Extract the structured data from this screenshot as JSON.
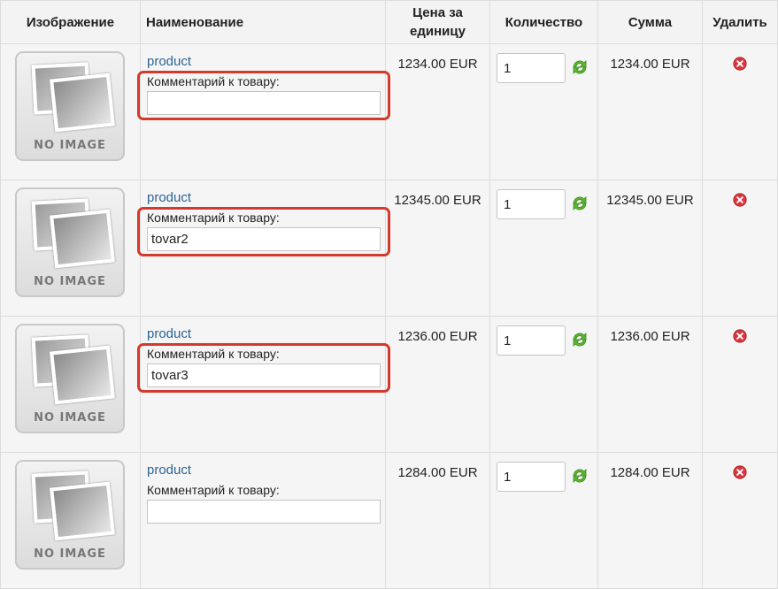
{
  "headers": {
    "image": "Изображение",
    "name": "Наименование",
    "price": "Цена за единицу",
    "quantity": "Количество",
    "sum": "Сумма",
    "delete": "Удалить"
  },
  "no_image_text": "NO IMAGE",
  "rows": [
    {
      "product": "product",
      "comment_label": "Комментарий к товару:",
      "comment": "",
      "price": "1234.00 EUR",
      "qty": "1",
      "sum": "1234.00 EUR",
      "highlighted": true
    },
    {
      "product": "product",
      "comment_label": "Комментарий к товару:",
      "comment": "tovar2",
      "price": "12345.00 EUR",
      "qty": "1",
      "sum": "12345.00 EUR",
      "highlighted": true
    },
    {
      "product": "product",
      "comment_label": "Комментарий к товару:",
      "comment": "tovar3",
      "price": "1236.00 EUR",
      "qty": "1",
      "sum": "1236.00 EUR",
      "highlighted": true
    },
    {
      "product": "product",
      "comment_label": "Комментарий к товару:",
      "comment": "",
      "price": "1284.00 EUR",
      "qty": "1",
      "sum": "1284.00 EUR",
      "highlighted": false
    }
  ],
  "colors": {
    "highlight": "#d23a2e",
    "link": "#2a6496",
    "refresh": "#5cb531",
    "delete": "#d9363e"
  },
  "icons": {
    "refresh": "refresh-icon",
    "delete": "delete-icon",
    "placeholder": "no-image-icon"
  }
}
